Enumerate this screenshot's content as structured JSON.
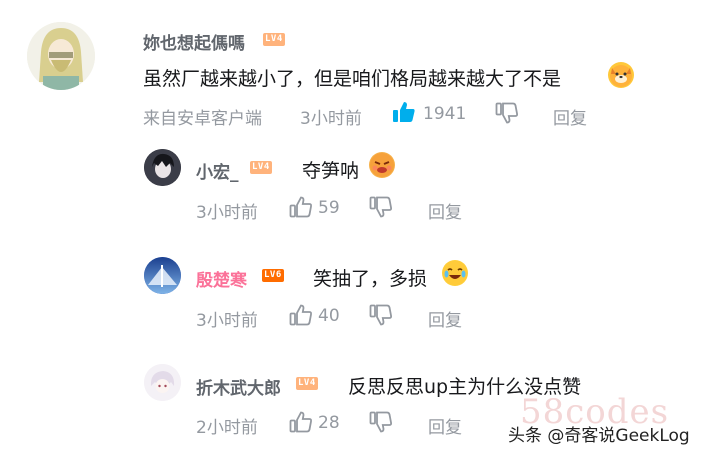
{
  "comment": {
    "username": "妳也想起傌嗎",
    "level": "LV4",
    "text": "虽然厂越来越小了，但是咱们格局越来越大了不是",
    "emoji": "dog-emoji",
    "source": "来自安卓客户端",
    "time": "3小时前",
    "likes": "1941",
    "reply_label": "回复"
  },
  "replies": [
    {
      "username": "小宏_",
      "level": "LV4",
      "text": "夺笋呐",
      "emoji": "angry-emoji",
      "time": "3小时前",
      "likes": "59",
      "reply_label": "回复"
    },
    {
      "username": "殷楚寒",
      "level": "LV6",
      "text": "笑抽了，多损",
      "emoji": "laugh-cry-emoji",
      "time": "3小时前",
      "likes": "40",
      "reply_label": "回复"
    },
    {
      "username": "折木武大郎",
      "level": "LV4",
      "text": "反思反思up主为什么没点赞",
      "time": "2小时前",
      "likes": "28",
      "reply_label": "回复"
    }
  ],
  "watermark": "58codes",
  "source_credit": "头条 @奇客说GeekLog",
  "colors": {
    "like_active": "#00aeec",
    "meta": "#9499a0",
    "vip_name": "#fb7299"
  }
}
